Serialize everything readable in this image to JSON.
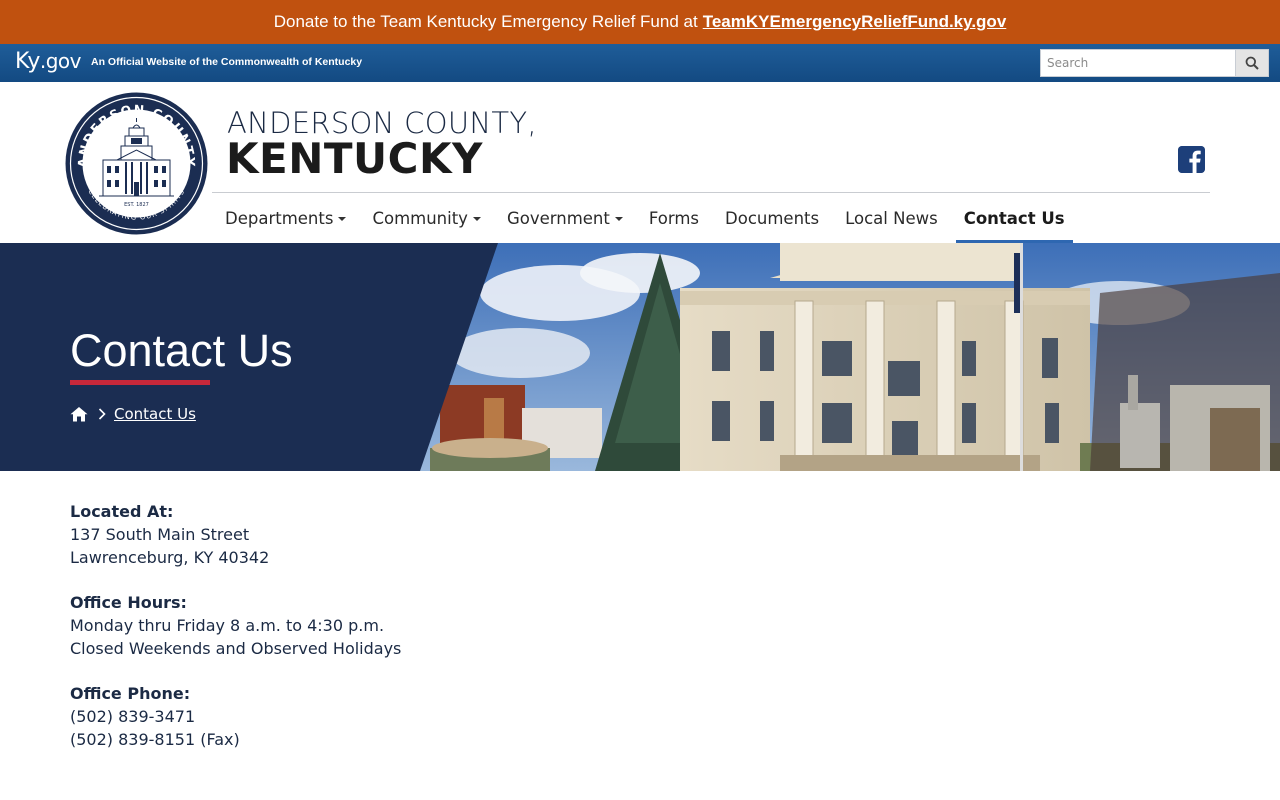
{
  "donate": {
    "text": "Donate to the Team Kentucky Emergency Relief Fund at",
    "link": "TeamKYEmergencyReliefFund.ky.gov"
  },
  "kygov": {
    "logo_ky": "Ky",
    "logo_gov": ".gov",
    "tagline": "An Official Website of the Commonwealth of Kentucky",
    "search_placeholder": "Search",
    "search_icon": "search-icon"
  },
  "header": {
    "title_top": "ANDERSON COUNTY,",
    "title_main": "KENTUCKY",
    "seal_top": "ANDERSON COUNTY",
    "seal_bottom": "CELEBRATING OUR SPIRITS",
    "seal_est": "EST. 1827",
    "social_icon": "facebook-icon",
    "colors": {
      "navy": "#1b2d52",
      "accent_orange": "#c0510f",
      "active_underline": "#2e67b1",
      "hero_underline": "#c7283a"
    }
  },
  "nav": {
    "items": [
      {
        "label": "Departments",
        "dropdown": true
      },
      {
        "label": "Community",
        "dropdown": true
      },
      {
        "label": "Government",
        "dropdown": true
      },
      {
        "label": "Forms",
        "dropdown": false
      },
      {
        "label": "Documents",
        "dropdown": false
      },
      {
        "label": "Local News",
        "dropdown": false
      },
      {
        "label": "Contact Us",
        "dropdown": false,
        "active": true
      }
    ]
  },
  "hero": {
    "title": "Contact Us",
    "home_icon": "home-icon",
    "breadcrumb_current": "Contact Us"
  },
  "content": {
    "location_label": "Located At:",
    "address_line1": "137 South Main Street",
    "address_line2": "Lawrenceburg, KY 40342",
    "hours_label": "Office Hours:",
    "hours_line1": "Monday thru Friday 8 a.m. to 4:30 p.m.",
    "hours_line2": "Closed Weekends and Observed Holidays",
    "phone_label": "Office Phone:",
    "phone_line1": "(502) 839-3471",
    "phone_line2": "(502) 839-8151 (Fax)"
  }
}
